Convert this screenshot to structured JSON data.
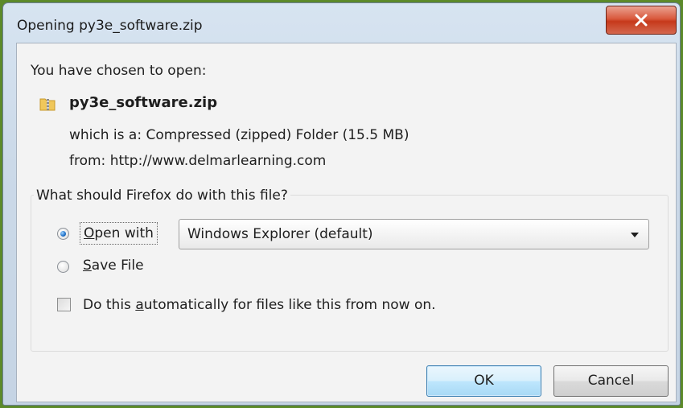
{
  "window": {
    "title": "Opening py3e_software.zip",
    "close_icon": "close-x-icon"
  },
  "dialog": {
    "intro": "You have chosen to open:",
    "file_icon": "zip-file-icon",
    "filename": "py3e_software.zip",
    "which_is": "which is a: Compressed (zipped) Folder (15.5 MB)",
    "from": "from: http://www.delmarlearning.com"
  },
  "action_group": {
    "label": "What should Firefox do with this file?",
    "open_with": {
      "prefix_underlined": "O",
      "rest": "pen with",
      "selected": true
    },
    "open_with_app": "Windows Explorer (default)",
    "save_file": {
      "prefix_underlined": "S",
      "rest": "ave File",
      "selected": false
    },
    "auto_checkbox": {
      "before": "Do this ",
      "underlined": "a",
      "after": "utomatically for files like this from now on.",
      "checked": false
    }
  },
  "buttons": {
    "ok": "OK",
    "cancel": "Cancel"
  },
  "colors": {
    "close_button": "#d3563a",
    "ok_button_border": "#3c7fb1",
    "radio_selected": "#1d6fc7"
  }
}
